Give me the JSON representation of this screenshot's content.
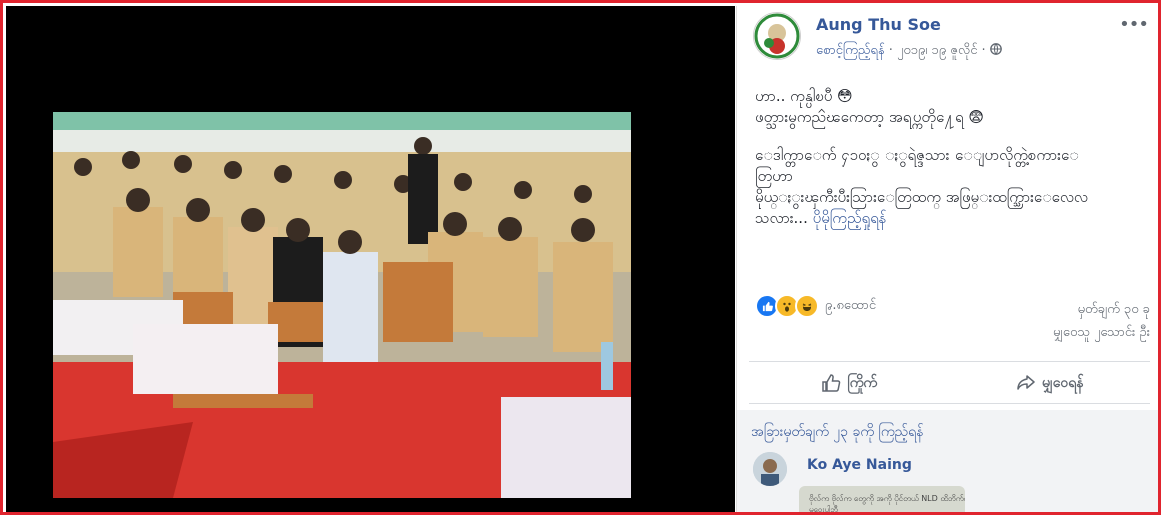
{
  "post": {
    "author": "Aung Thu Soe",
    "meta_link": "စောင့်ကြည့်ရန်",
    "date": "၂၀၁၉၊ ၁၉ ဇူလိုင်",
    "privacy_icon": "globe-icon",
    "lines": [
      "ဟာ.. ကုန္ပါၿပီ 😳",
      "ဖတ္သားမွကညၳၽကေတာ့ အရပ္ကတို႔ေရ 😨",
      "",
      "ေဒါက္တာေက် ႁ၁၀ႏွ ႏွရဲဇ္ဒသား ေျပာလိုက္တဲ့စကားေ",
      "တြဟာ",
      "မိုယ္ႏွးၾကီးပီးသြားေတြထက္ အဖြမ္းထက္သြားေလေလ",
      "သလား..."
    ],
    "see_more": "ပိုမိုကြည့်ရှုရန်",
    "reaction_count": "၉.၈ထောင်",
    "comments_count": "မှတ်ချက် ၃၀ ခု",
    "shares_count": "မျှဝေသူ ၂သောင်း ဦး",
    "like_label": "ကြိုက်",
    "share_label": "မျှဝေရန်",
    "more_comments": "အခြားမှတ်ချက် ၂၃ ခုကို ကြည့်ရန်",
    "comment_author": "Ko Aye Naing",
    "comment_image_text": "ဗိုလ်က ဗိုလ်က တွေကို အကို ပိုင်တယ် NLD ထိဘိက်ကိုပြောတို ဗိုလ်တွေ",
    "comment_image_text2": "မဝေးပါဘီ"
  },
  "colors": {
    "border": "#e0242e",
    "link": "#365899",
    "like": "#1877f2",
    "carpet": "#d9362f"
  }
}
